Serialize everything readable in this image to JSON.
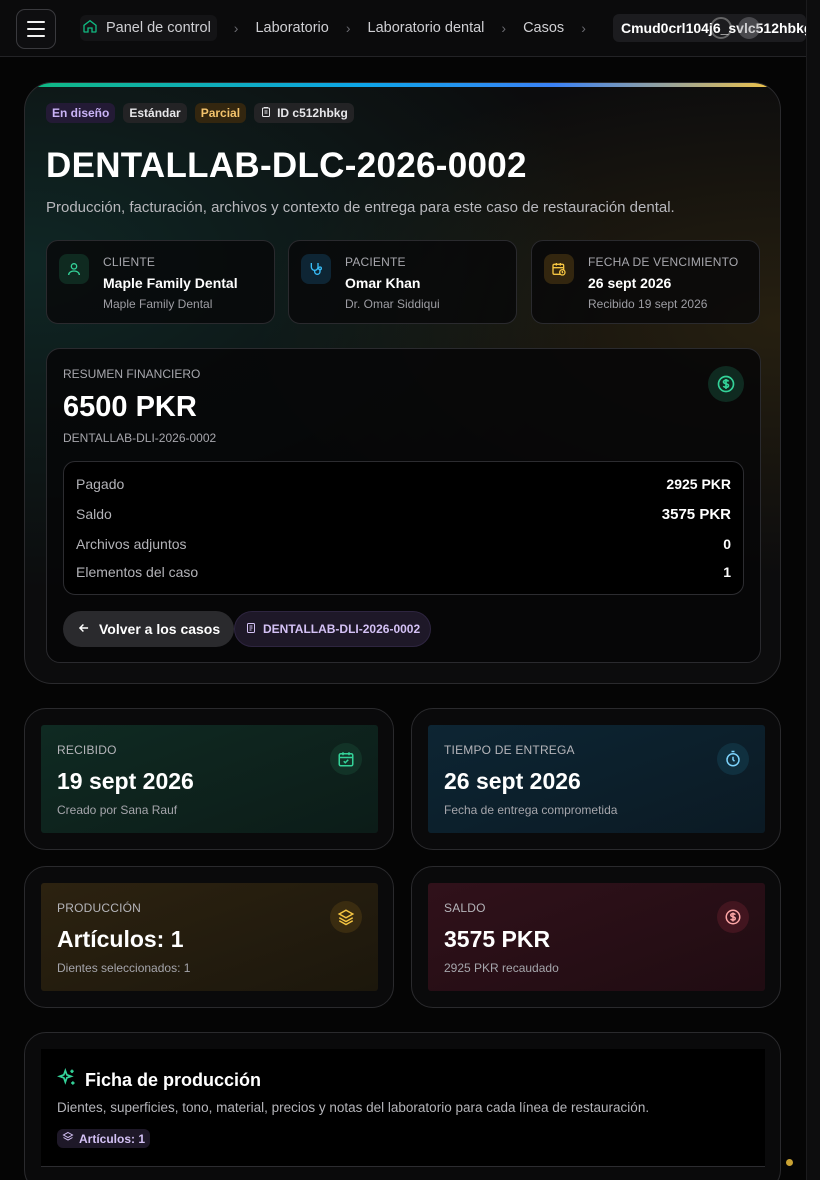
{
  "breadcrumb": {
    "items": [
      "Panel de control",
      "Laboratorio",
      "Laboratorio dental",
      "Casos"
    ],
    "current": "Cmud0crl104j6_svlc512hbkg"
  },
  "case": {
    "badges": {
      "status": "En diseño",
      "type": "Estándar",
      "payment": "Parcial",
      "id": "ID c512hbkg"
    },
    "title": "DENTALLAB-DLC-2026-0002",
    "subtitle": "Producción, facturación, archivos y contexto de entrega para este caso de restauración dental."
  },
  "info_cards": {
    "client": {
      "label": "CLIENTE",
      "value": "Maple Family Dental",
      "sub": "Maple Family Dental"
    },
    "patient": {
      "label": "PACIENTE",
      "value": "Omar Khan",
      "sub": "Dr. Omar Siddiqui"
    },
    "due": {
      "label": "FECHA DE VENCIMIENTO",
      "value": "26 sept 2026",
      "sub": "Recibido 19 sept 2026"
    }
  },
  "financial": {
    "label": "RESUMEN FINANCIERO",
    "amount": "6500 PKR",
    "invoice_code": "DENTALLAB-DLI-2026-0002",
    "rows": [
      {
        "key": "Pagado",
        "value": "2925 PKR"
      },
      {
        "key": "Saldo",
        "value": "3575 PKR"
      },
      {
        "key": "Archivos adjuntos",
        "value": "0"
      },
      {
        "key": "Elementos del caso",
        "value": "1"
      }
    ],
    "back_label": "Volver a los casos",
    "invoice_link": "DENTALLAB-DLI-2026-0002"
  },
  "stats": {
    "received": {
      "label": "RECIBIDO",
      "value": "19 sept 2026",
      "sub": "Creado por Sana Rauf"
    },
    "delivery": {
      "label": "TIEMPO DE ENTREGA",
      "value": "26 sept 2026",
      "sub": "Fecha de entrega comprometida"
    },
    "production": {
      "label": "PRODUCCIÓN",
      "value": "Artículos: 1",
      "sub": "Dientes seleccionados: 1"
    },
    "balance": {
      "label": "SALDO",
      "value": "3575 PKR",
      "sub": "2925 PKR recaudado"
    }
  },
  "production_sheet": {
    "title": "Ficha de producción",
    "description": "Dientes, superficies, tono, material, precios y notas del laboratorio para cada línea de restauración.",
    "chip": "Artículos: 1"
  },
  "colors": {
    "accent_green": "#10b981",
    "accent_blue": "#0ea5e9",
    "accent_gold": "#f5c542",
    "accent_violet": "#c9b3f6",
    "danger": "#f87171"
  }
}
